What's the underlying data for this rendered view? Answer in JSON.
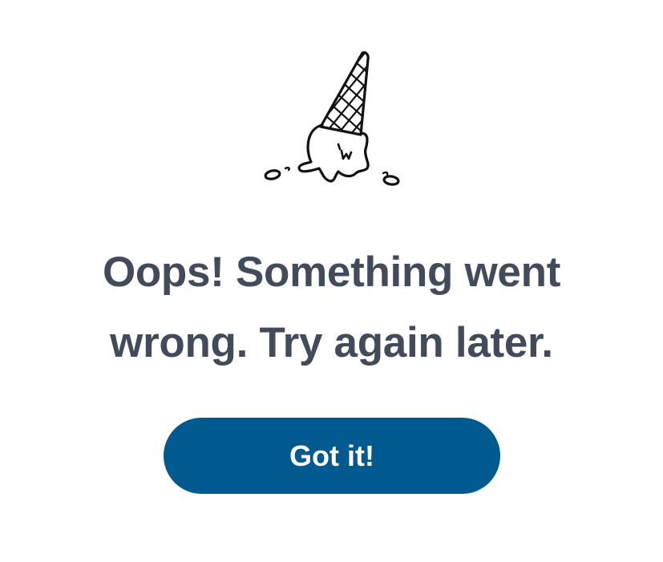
{
  "dialog": {
    "illustration_icon": "dropped-ice-cream-cone-icon",
    "message": "Oops! Something went wrong. Try again later.",
    "dismiss_button_label": "Got it!"
  },
  "colors": {
    "text": "#424b59",
    "button_background": "#005a8f",
    "button_text": "#ffffff",
    "background": "#ffffff"
  }
}
